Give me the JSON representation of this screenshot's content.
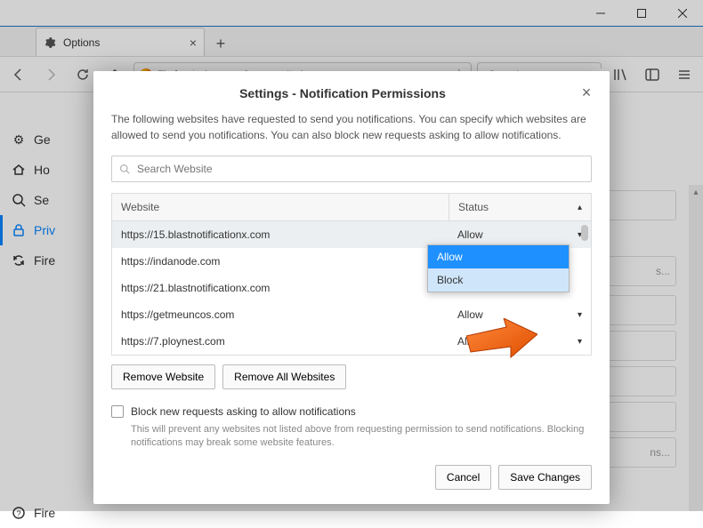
{
  "window": {
    "tab_title": "Options",
    "url_label": "Firefox",
    "url": "about:preferences#privacy",
    "search_placeholder": "Search"
  },
  "sidebar": {
    "items": [
      {
        "label": "Ge",
        "icon": "gear"
      },
      {
        "label": "Ho",
        "icon": "home"
      },
      {
        "label": "Se",
        "icon": "search"
      },
      {
        "label": "Priv",
        "icon": "lock"
      },
      {
        "label": "Fire",
        "icon": "sync"
      }
    ],
    "help": "Fire"
  },
  "ghost_rows": [
    "",
    "s...",
    "",
    "",
    "",
    "",
    "ns..."
  ],
  "dialog": {
    "title": "Settings - Notification Permissions",
    "description": "The following websites have requested to send you notifications. You can specify which websites are allowed to send you notifications. You can also block new requests asking to allow notifications.",
    "search_placeholder": "Search Website",
    "th_website": "Website",
    "th_status": "Status",
    "rows": [
      {
        "site": "https://15.blastnotificationx.com",
        "status": "Allow"
      },
      {
        "site": "https://indanode.com",
        "status": ""
      },
      {
        "site": "https://21.blastnotificationx.com",
        "status": ""
      },
      {
        "site": "https://getmeuncos.com",
        "status": "Allow"
      },
      {
        "site": "https://7.ploynest.com",
        "status": "Allow"
      }
    ],
    "dropdown": {
      "options": [
        "Allow",
        "Block"
      ]
    },
    "remove_website": "Remove Website",
    "remove_all": "Remove All Websites",
    "checkbox_label": "Block new requests asking to allow notifications",
    "checkbox_desc": "This will prevent any websites not listed above from requesting permission to send notifications. Blocking notifications may break some website features.",
    "cancel": "Cancel",
    "save": "Save Changes"
  }
}
